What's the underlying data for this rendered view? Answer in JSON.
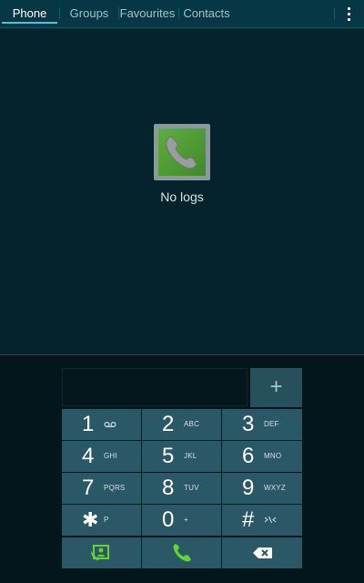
{
  "tabs": [
    {
      "label": "Phone",
      "active": true
    },
    {
      "label": "Groups",
      "active": false
    },
    {
      "label": "Favourites",
      "active": false
    },
    {
      "label": "Contacts",
      "active": false
    }
  ],
  "logs": {
    "empty_text": "No logs"
  },
  "dialer": {
    "add_label": "+",
    "keys": [
      {
        "digit": "1",
        "letters": ""
      },
      {
        "digit": "2",
        "letters": "ABC"
      },
      {
        "digit": "3",
        "letters": "DEF"
      },
      {
        "digit": "4",
        "letters": "GHI"
      },
      {
        "digit": "5",
        "letters": "JKL"
      },
      {
        "digit": "6",
        "letters": "MNO"
      },
      {
        "digit": "7",
        "letters": "PQRS"
      },
      {
        "digit": "8",
        "letters": "TUV"
      },
      {
        "digit": "9",
        "letters": "WXYZ"
      },
      {
        "digit": "✱",
        "letters": "P"
      },
      {
        "digit": "0",
        "letters": "+"
      },
      {
        "digit": "#",
        "letters": ""
      }
    ]
  },
  "colors": {
    "accent": "#59c0d6",
    "call_green": "#5fd92b",
    "key_bg": "#2b5867"
  }
}
